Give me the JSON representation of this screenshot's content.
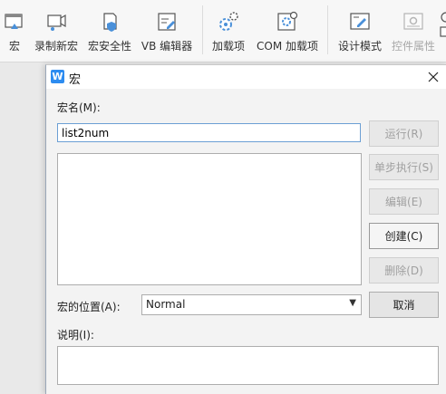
{
  "ribbon": {
    "items": [
      {
        "label": "宏",
        "icon": "macro-icon",
        "disabled": false
      },
      {
        "label": "录制新宏",
        "icon": "record-macro-icon",
        "disabled": false
      },
      {
        "label": "宏安全性",
        "icon": "macro-security-icon",
        "disabled": false
      },
      {
        "label": "VB 编辑器",
        "icon": "vb-editor-icon",
        "disabled": false
      },
      {
        "label": "加载项",
        "icon": "addins-icon",
        "disabled": false
      },
      {
        "label": "COM 加载项",
        "icon": "com-addins-icon",
        "disabled": false
      },
      {
        "label": "设计模式",
        "icon": "design-mode-icon",
        "disabled": false
      },
      {
        "label": "控件属性",
        "icon": "control-properties-icon",
        "disabled": true
      }
    ]
  },
  "dialog": {
    "app_icon_text": "W",
    "title": "宏",
    "macro_name_label": "宏名(M):",
    "macro_name_value": "list2num",
    "buttons": {
      "run": "运行(R)",
      "step_into": "单步执行(S)",
      "edit": "编辑(E)",
      "create": "创建(C)",
      "delete": "删除(D)",
      "cancel": "取消"
    },
    "location_label": "宏的位置(A):",
    "location_value": "Normal",
    "description_label": "说明(I):",
    "description_value": ""
  },
  "colors": {
    "app_icon": "#2d8cf0",
    "input_focus_border": "#6b9fd4",
    "disabled_text": "#a0a0a0"
  }
}
